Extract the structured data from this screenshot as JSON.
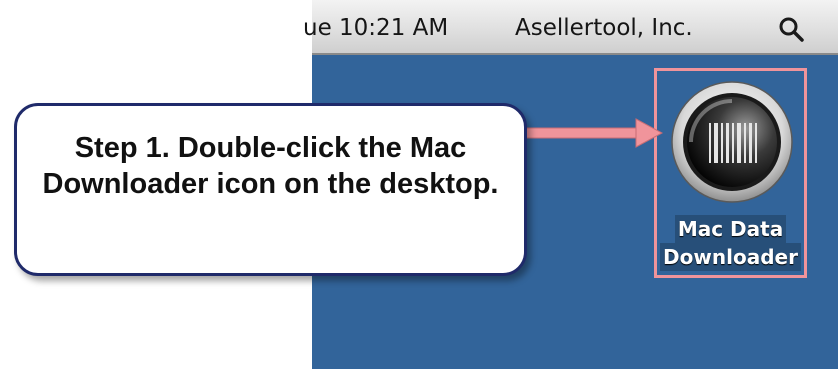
{
  "menubar": {
    "clock": "ue 10:21 AM",
    "company": "Asellertool, Inc.",
    "search_icon": "magnifier-icon"
  },
  "desktop": {
    "background_color": "#32649a",
    "icon": {
      "label_line1": "Mac Data",
      "label_line2": "Downloader",
      "icon_name": "mac-data-downloader-app-icon",
      "highlight_color": "#f0949b"
    }
  },
  "callout": {
    "text": "Step 1. Double-click the Mac Downloader icon on the desktop.",
    "border_color": "#1f2a6a",
    "arrow_color": "#f0949b"
  }
}
